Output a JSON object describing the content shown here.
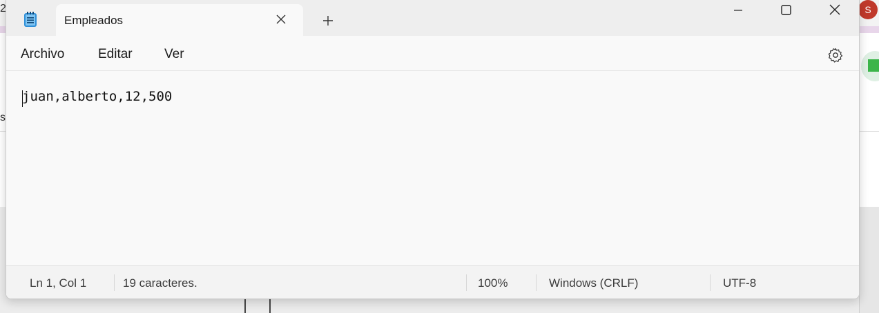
{
  "window": {
    "tab_title": "Empleados",
    "icons": {
      "app": "notepad-icon",
      "tab_close": "close-icon",
      "new_tab": "plus-icon",
      "minimize": "minimize-icon",
      "maximize": "maximize-icon",
      "close": "close-icon",
      "settings": "gear-icon"
    }
  },
  "menu": {
    "items": [
      "Archivo",
      "Editar",
      "Ver"
    ]
  },
  "editor": {
    "content": "juan,alberto,12,500"
  },
  "status": {
    "position": "Ln 1, Col 1",
    "characters": "19 caracteres.",
    "zoom": "100%",
    "line_ending": "Windows (CRLF)",
    "encoding": "UTF-8"
  },
  "background": {
    "avatar_initial": "S",
    "left_char_top": "2",
    "left_char_mid": "s"
  },
  "colors": {
    "avatar": "#c0392b",
    "titlebar": "#eeeeee",
    "editor": "#f9f9f9"
  }
}
